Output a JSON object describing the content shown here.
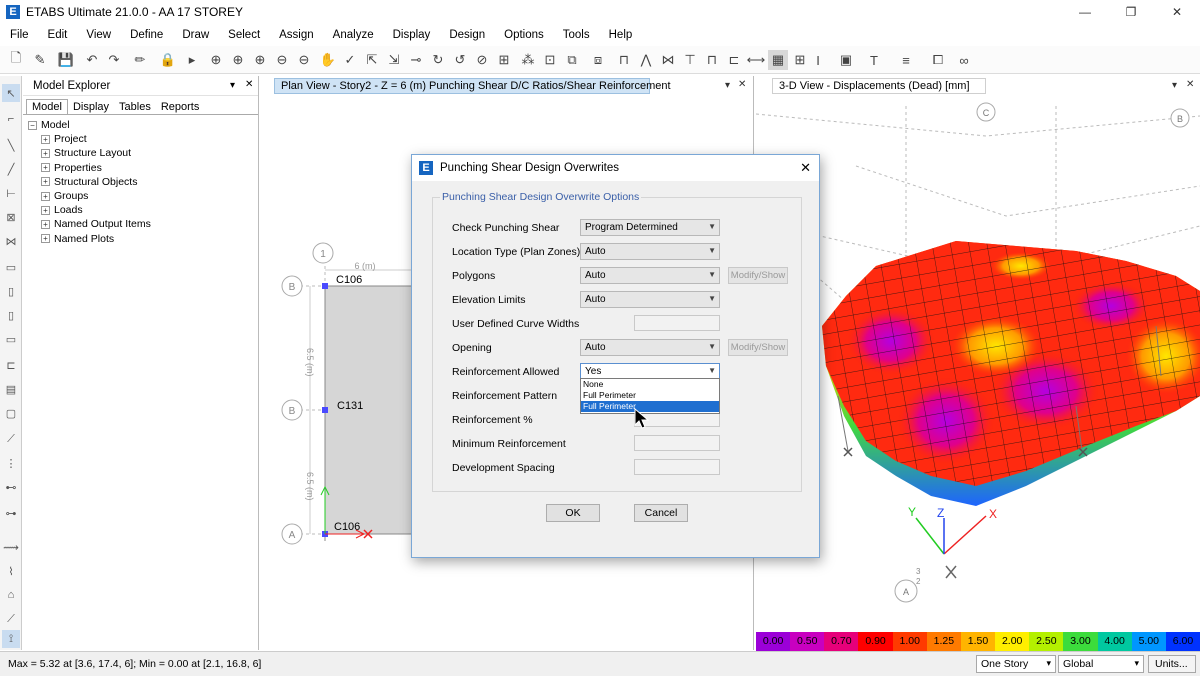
{
  "window": {
    "title": "ETABS Ultimate 21.0.0 - AA 17 STOREY",
    "app_letter": "E",
    "minimize": "—",
    "restore": "❐",
    "close": "✕"
  },
  "menu": [
    "File",
    "Edit",
    "View",
    "Define",
    "Draw",
    "Select",
    "Assign",
    "Analyze",
    "Display",
    "Design",
    "Options",
    "Tools",
    "Help"
  ],
  "explorer": {
    "title": "Model Explorer",
    "tabs": [
      "Model",
      "Display",
      "Tables",
      "Reports"
    ],
    "root": "Model",
    "items": [
      "Project",
      "Structure Layout",
      "Properties",
      "Structural Objects",
      "Groups",
      "Loads",
      "Named Output Items",
      "Named Plots"
    ]
  },
  "plan_view": {
    "tab_title": "Plan View - Story2 - Z = 6 (m)  Punching Shear D/C Ratios/Shear Reinforcement",
    "grid_1": "1",
    "grid_b1": "B",
    "grid_b2": "B",
    "grid_a": "A",
    "dim_top": "6 (m)",
    "dim_left1": "6.5 (m)",
    "dim_left2": "6.5 (m)",
    "col_c106_top": "C106",
    "col_c131": "C131",
    "col_c106_bottom": "C106"
  },
  "view3d": {
    "tab_title": "3-D View - Displacements (Dead)  [mm]",
    "label_c": "C",
    "label_b": "B",
    "label_a": "A",
    "axis_x": "X",
    "axis_y": "Y",
    "axis_z": "Z",
    "num_2": "2",
    "num_3": "3"
  },
  "legend": {
    "values": [
      "0.00",
      "0.50",
      "0.70",
      "0.90",
      "1.00",
      "1.25",
      "1.50",
      "2.00",
      "2.50",
      "3.00",
      "4.00",
      "5.00",
      "6.00"
    ],
    "colors": [
      "#9b00d8",
      "#c800c0",
      "#e6007a",
      "#ff0000",
      "#ff3a00",
      "#ff7a00",
      "#ffb400",
      "#ffee00",
      "#b4f000",
      "#3cdc3c",
      "#00c8a0",
      "#0096ff",
      "#0032ff"
    ]
  },
  "status": {
    "text": "Max = 5.32 at [3.6, 17.4, 6];  Min = 0.00 at [2.1, 16.8, 6]",
    "story_select": "One Story",
    "coord_select": "Global",
    "units_button": "Units..."
  },
  "dialog": {
    "title": "Punching Shear Design Overwrites",
    "group_title": "Punching Shear Design Overwrite Options",
    "rows": {
      "check_punching_label": "Check Punching Shear",
      "check_punching_value": "Program Determined",
      "location_type_label": "Location Type (Plan Zones)",
      "location_type_value": "Auto",
      "polygons_label": "Polygons",
      "polygons_value": "Auto",
      "elevation_label": "Elevation Limits",
      "elevation_value": "Auto",
      "curve_widths_label": "User Defined Curve Widths",
      "opening_label": "Opening",
      "opening_value": "Auto",
      "reinf_allowed_label": "Reinforcement Allowed",
      "reinf_allowed_value": "Yes",
      "reinf_pattern_label": "Reinforcement Pattern",
      "reinf_percent_label": "Reinforcement %",
      "min_reinf_label": "Minimum Reinforcement",
      "dev_spacing_label": "Development Spacing"
    },
    "modify_show": "Modify/Show",
    "dropdown_options": [
      "None",
      "Full Perimeter",
      "Full Perimeter"
    ],
    "ok": "OK",
    "cancel": "Cancel"
  }
}
